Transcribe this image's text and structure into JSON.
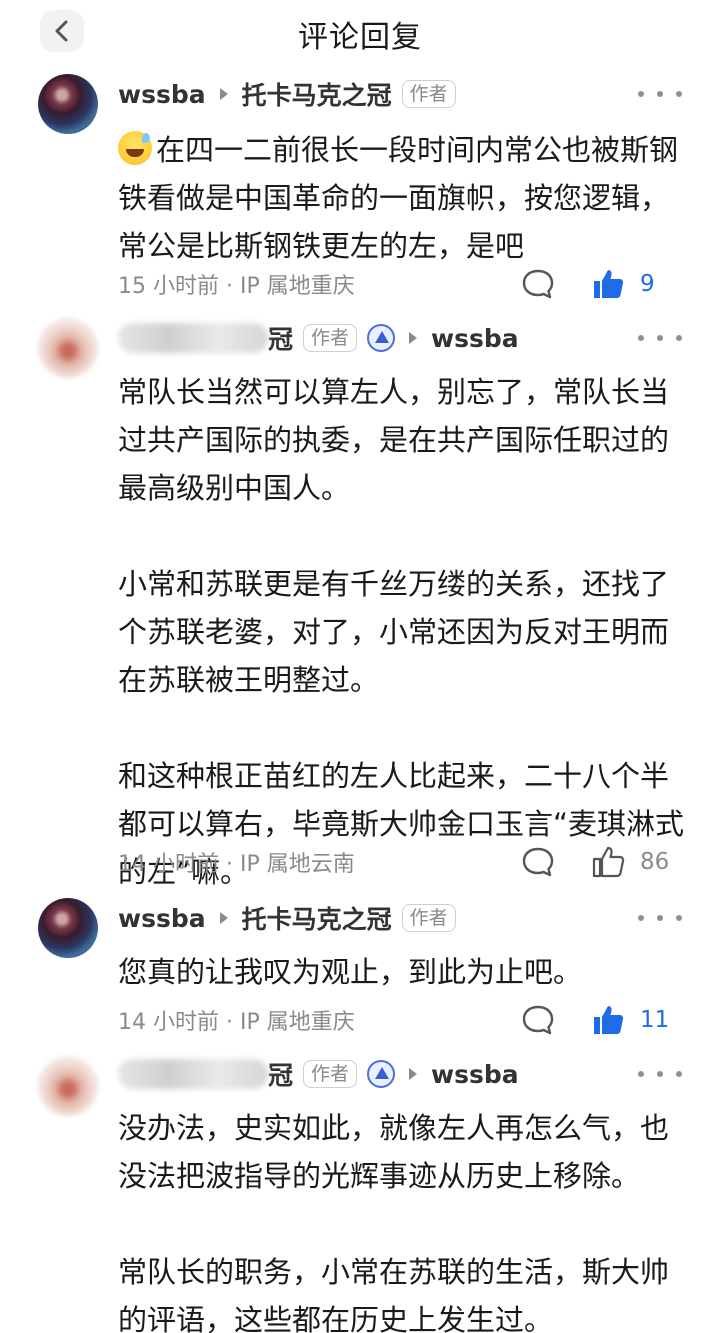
{
  "header": {
    "title": "评论回复",
    "back_icon": "chevron-left-icon"
  },
  "comments": [
    {
      "username": "wssba",
      "reply_to": "托卡马克之冠",
      "author_tag": "作者",
      "emoji": "sweat-smile-emoji",
      "paragraphs": [
        "在四一二前很长一段时间内常公也被斯钢铁看做是中国革命的一面旗帜，按您逻辑，常公是比斯钢铁更左的左，是吧"
      ],
      "time_location": "15 小时前 · IP 属地重庆",
      "likes": "9",
      "liked": true
    },
    {
      "username_visible_end": "冠",
      "author_tag": "作者",
      "reply_to": "wssba",
      "paragraphs": [
        "常队长当然可以算左人，别忘了，常队长当过共产国际的执委，是在共产国际任职过的最高级别中国人。",
        "小常和苏联更是有千丝万缕的关系，还找了个苏联老婆，对了，小常还因为反对王明而在苏联被王明整过。",
        "和这种根正苗红的左人比起来，二十八个半都可以算右，毕竟斯大帅金口玉言“麦琪淋式的左”嘛。"
      ],
      "time_location": "14 小时前 · IP 属地云南",
      "likes": "86",
      "liked": false
    },
    {
      "username": "wssba",
      "reply_to": "托卡马克之冠",
      "author_tag": "作者",
      "paragraphs": [
        "您真的让我叹为观止，到此为止吧。"
      ],
      "time_location": "14 小时前 · IP 属地重庆",
      "likes": "11",
      "liked": true
    },
    {
      "username_visible_end": "冠",
      "author_tag": "作者",
      "reply_to": "wssba",
      "paragraphs": [
        "没办法，史实如此，就像左人再怎么气，也没法把波指导的光辉事迹从历史上移除。",
        "常队长的职务，小常在苏联的生活，斯大帅的评语，这些都在历史上发生过。"
      ]
    }
  ],
  "colors": {
    "accent_blue": "#1f6ce6",
    "meta_gray": "#8a8a8a",
    "text": "#1a1a1a"
  }
}
